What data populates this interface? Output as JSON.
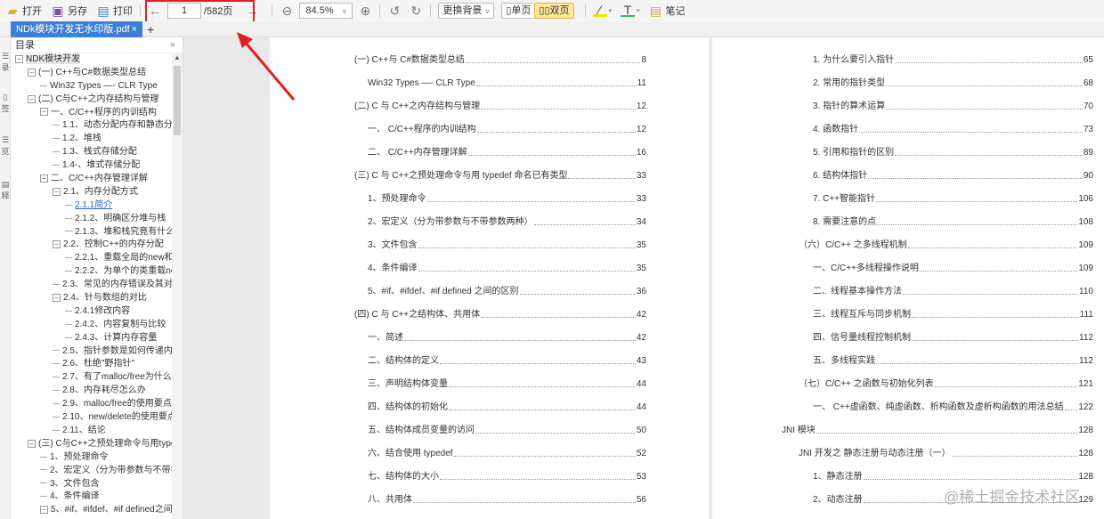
{
  "toolbar": {
    "open": "打开",
    "save_as": "另存",
    "print": "打印",
    "current_page": "1",
    "total_pages": "/582页",
    "zoom": "84.5%",
    "background": "更换背景",
    "single": "单页",
    "double": "双页",
    "notes": "笔记"
  },
  "tab": {
    "title": "NDk模块开发无水印版.pdf",
    "close": "×",
    "add": "+"
  },
  "strip": [
    "录",
    "签",
    "览",
    "释"
  ],
  "panel": {
    "title": "目录",
    "close": "×"
  },
  "tree": [
    {
      "l": 0,
      "t": "NDK模块开发",
      "e": 1
    },
    {
      "l": 1,
      "t": "(一) C++与C#数据类型总结",
      "e": 1
    },
    {
      "l": 2,
      "t": "Win32 Types —- CLR Type"
    },
    {
      "l": 1,
      "t": "(二) C与C++之内存结构与管理",
      "e": 1
    },
    {
      "l": 2,
      "t": "一、C/C++程序的内训结构",
      "e": 1
    },
    {
      "l": 3,
      "t": "1.1、动态分配内存和静态分配"
    },
    {
      "l": 3,
      "t": "1.2、堆栈"
    },
    {
      "l": 3,
      "t": "1.3、栈式存储分配"
    },
    {
      "l": 3,
      "t": "1.4-、堆式存储分配"
    },
    {
      "l": 2,
      "t": "二、C/C++内存管理详解",
      "e": 1
    },
    {
      "l": 3,
      "t": "2.1、内存分配方式",
      "e": 1
    },
    {
      "l": 4,
      "t": "2.1.1简介",
      "s": 1
    },
    {
      "l": 4,
      "t": "2.1.2、明确区分堆与栈"
    },
    {
      "l": 4,
      "t": "2.1.3、堆和栈究竟有什么区"
    },
    {
      "l": 3,
      "t": "2.2、控制C++的内存分配",
      "e": 1
    },
    {
      "l": 4,
      "t": "2.2.1、重载全局的new和d"
    },
    {
      "l": 4,
      "t": "2.2.2、为单个的类重载new"
    },
    {
      "l": 3,
      "t": "2.3、常见的内存错误及其对策"
    },
    {
      "l": 3,
      "t": "2.4、针与数组的对比",
      "e": 1
    },
    {
      "l": 4,
      "t": "2.4.1修改内容"
    },
    {
      "l": 4,
      "t": "2.4.2、内容复制与比较"
    },
    {
      "l": 4,
      "t": "2.4.3、计算内存容量"
    },
    {
      "l": 3,
      "t": "2.5、指针参数是如何传递内存"
    },
    {
      "l": 3,
      "t": "2.6、杜绝\"野指针\""
    },
    {
      "l": 3,
      "t": "2.7、有了malloc/free为什么还"
    },
    {
      "l": 3,
      "t": "2.8、内存耗尽怎么办"
    },
    {
      "l": 3,
      "t": "2.9、malloc/free的使用要点"
    },
    {
      "l": 3,
      "t": "2.10、new/delete的使用要点"
    },
    {
      "l": 3,
      "t": "2.11、结论"
    },
    {
      "l": 1,
      "t": "(三) C与C++之预处理命令与用type",
      "e": 1
    },
    {
      "l": 2,
      "t": "1、预处理命令"
    },
    {
      "l": 2,
      "t": "2、宏定义（分为带参数与不带参数"
    },
    {
      "l": 2,
      "t": "3、文件包含"
    },
    {
      "l": 2,
      "t": "4、条件编译"
    },
    {
      "l": 2,
      "t": "5、#if、#ifdef、#if defined之间",
      "e": 1
    }
  ],
  "left_page": [
    {
      "i": 0,
      "t": "(一) C++与 C#数据类型总结",
      "p": "8"
    },
    {
      "i": 1,
      "t": "Win32 Types —- CLR Type",
      "p": "11"
    },
    {
      "i": 0,
      "t": "(二) C 与 C++之内存结构与管理",
      "p": "12"
    },
    {
      "i": 1,
      "t": "一、 C/C++程序的内训结构",
      "p": "12"
    },
    {
      "i": 1,
      "t": "二、 C/C++内存管理详解",
      "p": "16"
    },
    {
      "i": 0,
      "t": "(三) C 与 C++之预处理命令与用 typedef 命名已有类型",
      "p": "33"
    },
    {
      "i": 1,
      "t": "1、预处理命令",
      "p": "33"
    },
    {
      "i": 1,
      "t": "2、宏定义（分为带参数与不带参数两种）",
      "p": "34"
    },
    {
      "i": 1,
      "t": "3、文件包含",
      "p": "35"
    },
    {
      "i": 1,
      "t": "4、条件编译",
      "p": "35"
    },
    {
      "i": 1,
      "t": "5、#if、#ifdef、#if defined 之间的区别",
      "p": "36"
    },
    {
      "i": 0,
      "t": "(四) C 与 C++之结构体、共用体",
      "p": "42"
    },
    {
      "i": 1,
      "t": "一、简述",
      "p": "42"
    },
    {
      "i": 1,
      "t": "二、结构体的定义",
      "p": "43"
    },
    {
      "i": 1,
      "t": "三、声明结构体变量",
      "p": "44"
    },
    {
      "i": 1,
      "t": "四、结构体的初始化",
      "p": "44"
    },
    {
      "i": 1,
      "t": "五、结构体成员变量的访问",
      "p": "50"
    },
    {
      "i": 1,
      "t": "六、结合使用 typedef",
      "p": "52"
    },
    {
      "i": 1,
      "t": "七、结构体的大小",
      "p": "53"
    },
    {
      "i": 1,
      "t": "八、共用体",
      "p": "56"
    }
  ],
  "right_page": [
    {
      "i": 2,
      "t": "1. 为什么要引入指针",
      "p": "65"
    },
    {
      "i": 2,
      "t": "2. 常用的指针类型",
      "p": "68"
    },
    {
      "i": 2,
      "t": "3. 指针的算术运算",
      "p": "70"
    },
    {
      "i": 2,
      "t": "4. 函数指针",
      "p": "73"
    },
    {
      "i": 2,
      "t": "5. 引用和指针的区别",
      "p": "89"
    },
    {
      "i": 2,
      "t": "6. 结构体指针",
      "p": "90"
    },
    {
      "i": 2,
      "t": "7. C++智能指针",
      "p": "106"
    },
    {
      "i": 2,
      "t": "8. 需要注意的点",
      "p": "108"
    },
    {
      "i": 1,
      "t": "（六）C/C++ 之多线程机制",
      "p": "109"
    },
    {
      "i": 2,
      "t": "一、C/C++多线程操作说明",
      "p": "109"
    },
    {
      "i": 2,
      "t": "二、线程基本操作方法",
      "p": "110"
    },
    {
      "i": 2,
      "t": "三、线程互斥与同步机制",
      "p": "111"
    },
    {
      "i": 2,
      "t": "四、信号量线程控制机制",
      "p": "112"
    },
    {
      "i": 2,
      "t": "五、多线程实践",
      "p": "112"
    },
    {
      "i": 1,
      "t": "（七）C/C++ 之函数与初始化列表",
      "p": "121"
    },
    {
      "i": 2,
      "t": "一、 C++虚函数、纯虚函数、析构函数及虚析构函数的用法总结",
      "p": "122"
    },
    {
      "i": 0,
      "t": "JNI 模块",
      "p": "128"
    },
    {
      "i": 1,
      "t": "JNI 开发之 静态注册与动态注册（一）",
      "p": "128"
    },
    {
      "i": 2,
      "t": "1、静态注册",
      "p": "128"
    },
    {
      "i": 2,
      "t": "2、动态注册",
      "p": "129"
    }
  ],
  "watermark": "@稀土掘金技术社区",
  "colors": {
    "accent": "#3d7fd6",
    "highlight_box": "#e02020",
    "active_button": "#fde59a"
  }
}
